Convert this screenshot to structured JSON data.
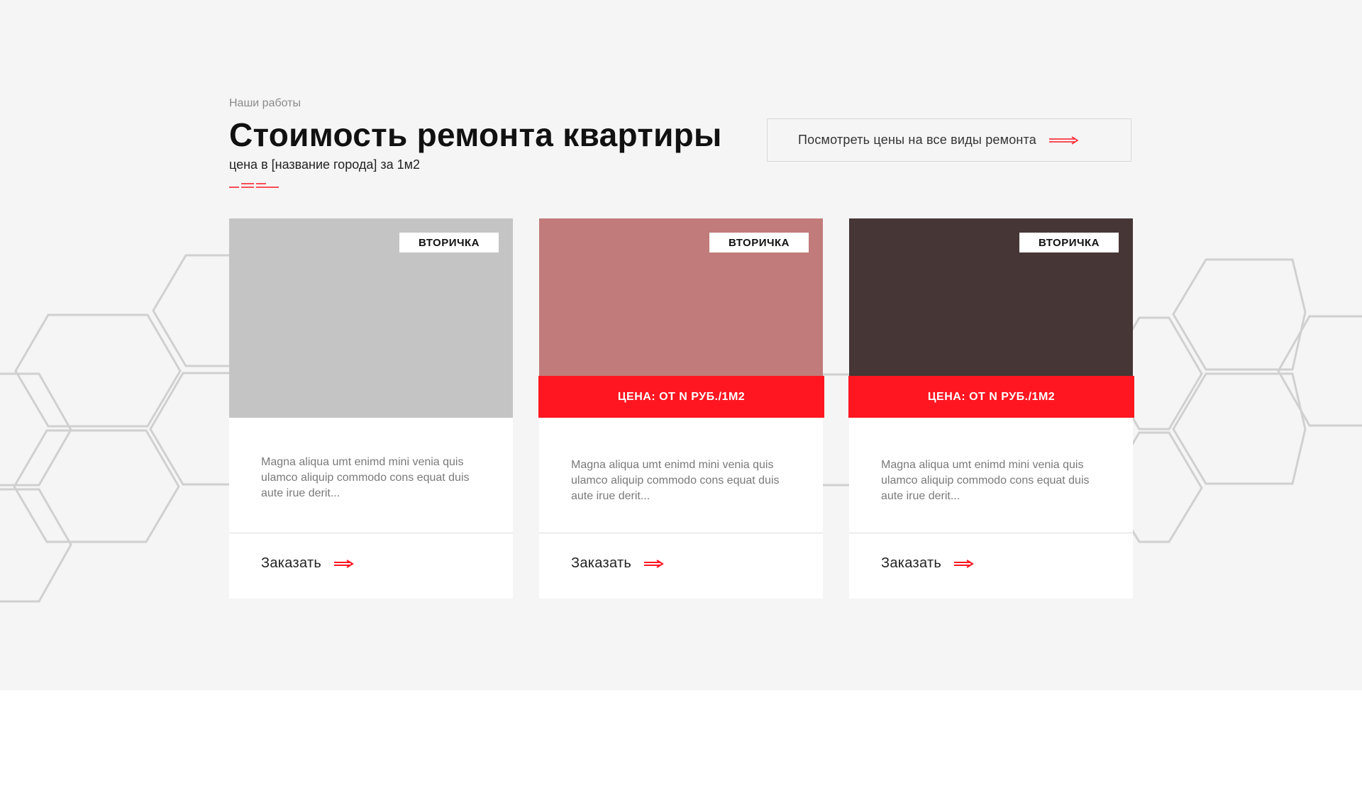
{
  "header": {
    "eyebrow": "Наши работы",
    "title": "Стоимость ремонта квартиры",
    "subtitle": "цена в [название города] за 1м2",
    "prices_button_label": "Посмотреть цены на все виды ремонта"
  },
  "colors": {
    "accent": "#ff1621",
    "background": "#f5f5f5",
    "card": "#ffffff"
  },
  "cards": [
    {
      "badge": "ВТОРИЧКА",
      "image_color": "#c4c4c4",
      "price": "",
      "text": "Magna aliqua umt enimd mini venia quis ulamco aliquip commodo cons equat duis aute irue derit...",
      "order_label": "Заказать"
    },
    {
      "badge": "ВТОРИЧКА",
      "image_color": "#c17b7a",
      "price": "ЦЕНА: ОТ N РУБ./1М2",
      "text": "Magna aliqua umt enimd mini venia quis ulamco aliquip commodo cons equat duis aute irue derit...",
      "order_label": "Заказать"
    },
    {
      "badge": "ВТОРИЧКА",
      "image_color": "#463636",
      "price": "ЦЕНА: ОТ N РУБ./1М2",
      "text": "Magna aliqua umt enimd mini venia quis ulamco aliquip commodo cons equat duis aute irue derit...",
      "order_label": "Заказать"
    }
  ],
  "icons": {
    "arrow": "arrow-right-icon",
    "accent": "accent-lines"
  }
}
